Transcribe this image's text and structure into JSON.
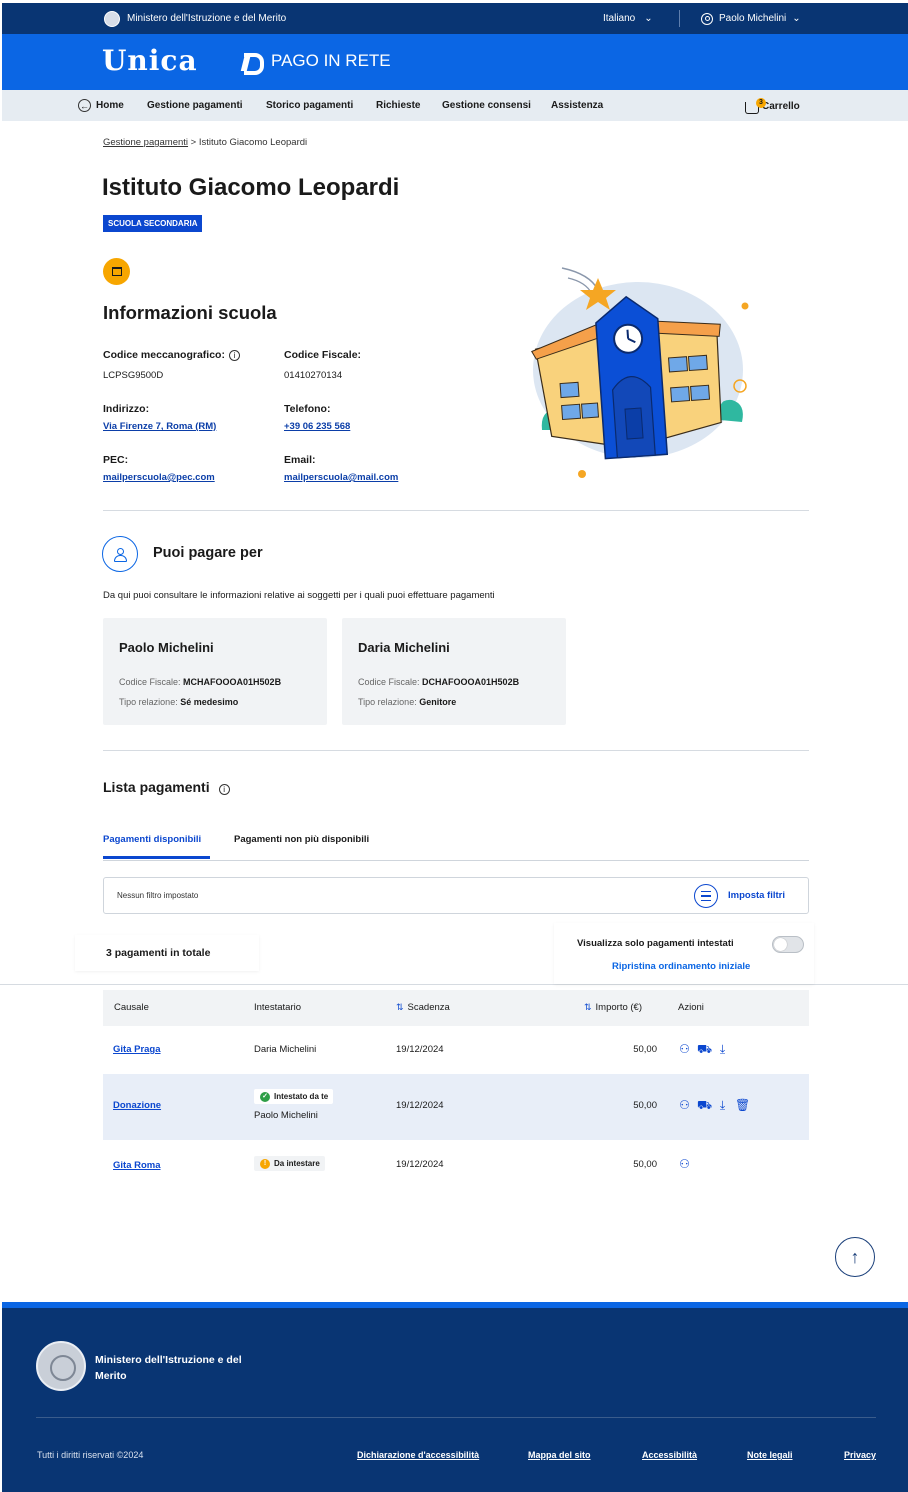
{
  "topbar": {
    "ministry": "Ministero dell'Istruzione e del Merito",
    "language": "Italiano",
    "user": "Paolo Michelini"
  },
  "brand": {
    "unica": "Unica",
    "pago": "PAGO IN RETE"
  },
  "nav": {
    "home": "Home",
    "items": [
      "Gestione pagamenti",
      "Storico pagamenti",
      "Richieste",
      "Gestione consensi",
      "Assistenza"
    ],
    "cart_label": "Carrello",
    "cart_count": "3"
  },
  "breadcrumb": {
    "parent": "Gestione pagamenti",
    "separator": ">",
    "current": "Istituto Giacomo Leopardi"
  },
  "school": {
    "title": "Istituto Giacomo Leopardi",
    "badge": "SCUOLA SECONDARIA",
    "section_title": "Informazioni scuola",
    "fields": {
      "codice_mecc_label": "Codice meccanografico:",
      "codice_mecc": "LCPSG9500D",
      "cf_label": "Codice Fiscale:",
      "cf": "01410270134",
      "indirizzo_label": "Indirizzo:",
      "indirizzo": "Via Firenze 7, Roma (RM)",
      "telefono_label": "Telefono:",
      "telefono": "+39 06 235 568",
      "pec_label": "PEC:",
      "pec": "mailperscuola@pec.com",
      "email_label": "Email:",
      "email": "mailperscuola@mail.com"
    }
  },
  "puoi_pagare": {
    "title": "Puoi pagare per",
    "description": "Da qui puoi consultare le informazioni relative ai soggetti per i quali puoi effettuare pagamenti",
    "cf_label": "Codice Fiscale:",
    "rel_label": "Tipo relazione:",
    "people": [
      {
        "name": "Paolo Michelini",
        "cf": "MCHAFOOOA01H502B",
        "relazione": "Sé medesimo"
      },
      {
        "name": "Daria Michelini",
        "cf": "DCHAFOOOA01H502B",
        "relazione": "Genitore"
      }
    ]
  },
  "lista": {
    "title": "Lista pagamenti",
    "tabs": [
      "Pagamenti disponibili",
      "Pagamenti non più disponibili"
    ],
    "filter_placeholder": "Nessun filtro impostato",
    "filter_button": "Imposta filtri",
    "total": "3 pagamenti in totale",
    "toggle_label": "Visualizza solo pagamenti intestati",
    "reset_label": "Ripristina ordinamento iniziale",
    "columns": [
      "Causale",
      "Intestatario",
      "Scadenza",
      "Importo (€)",
      "Azioni"
    ],
    "rows": [
      {
        "causale": "Gita Praga",
        "intestatario": "Daria Michelini",
        "scadenza": "19/12/2024",
        "importo": "50,00"
      },
      {
        "causale": "Donazione",
        "status": "Intestato da te",
        "intestatario": "Paolo Michelini",
        "scadenza": "19/12/2024",
        "importo": "50,00"
      },
      {
        "causale": "Gita Roma",
        "status": "Da intestare",
        "scadenza": "19/12/2024",
        "importo": "50,00"
      }
    ]
  },
  "footer": {
    "ministry": "Ministero dell'Istruzione e del Merito",
    "copyright": "Tutti i diritti riservati ©2024",
    "links": [
      "Dichiarazione d'accessibilità",
      "Mappa del sito",
      "Accessibilità",
      "Note legali",
      "Privacy"
    ]
  },
  "colors": {
    "primary": "#0b66e4",
    "dark_blue": "#093573",
    "accent": "#f7a600",
    "link": "#0b47cf",
    "success": "#2e9e47",
    "warning": "#f7a600"
  }
}
